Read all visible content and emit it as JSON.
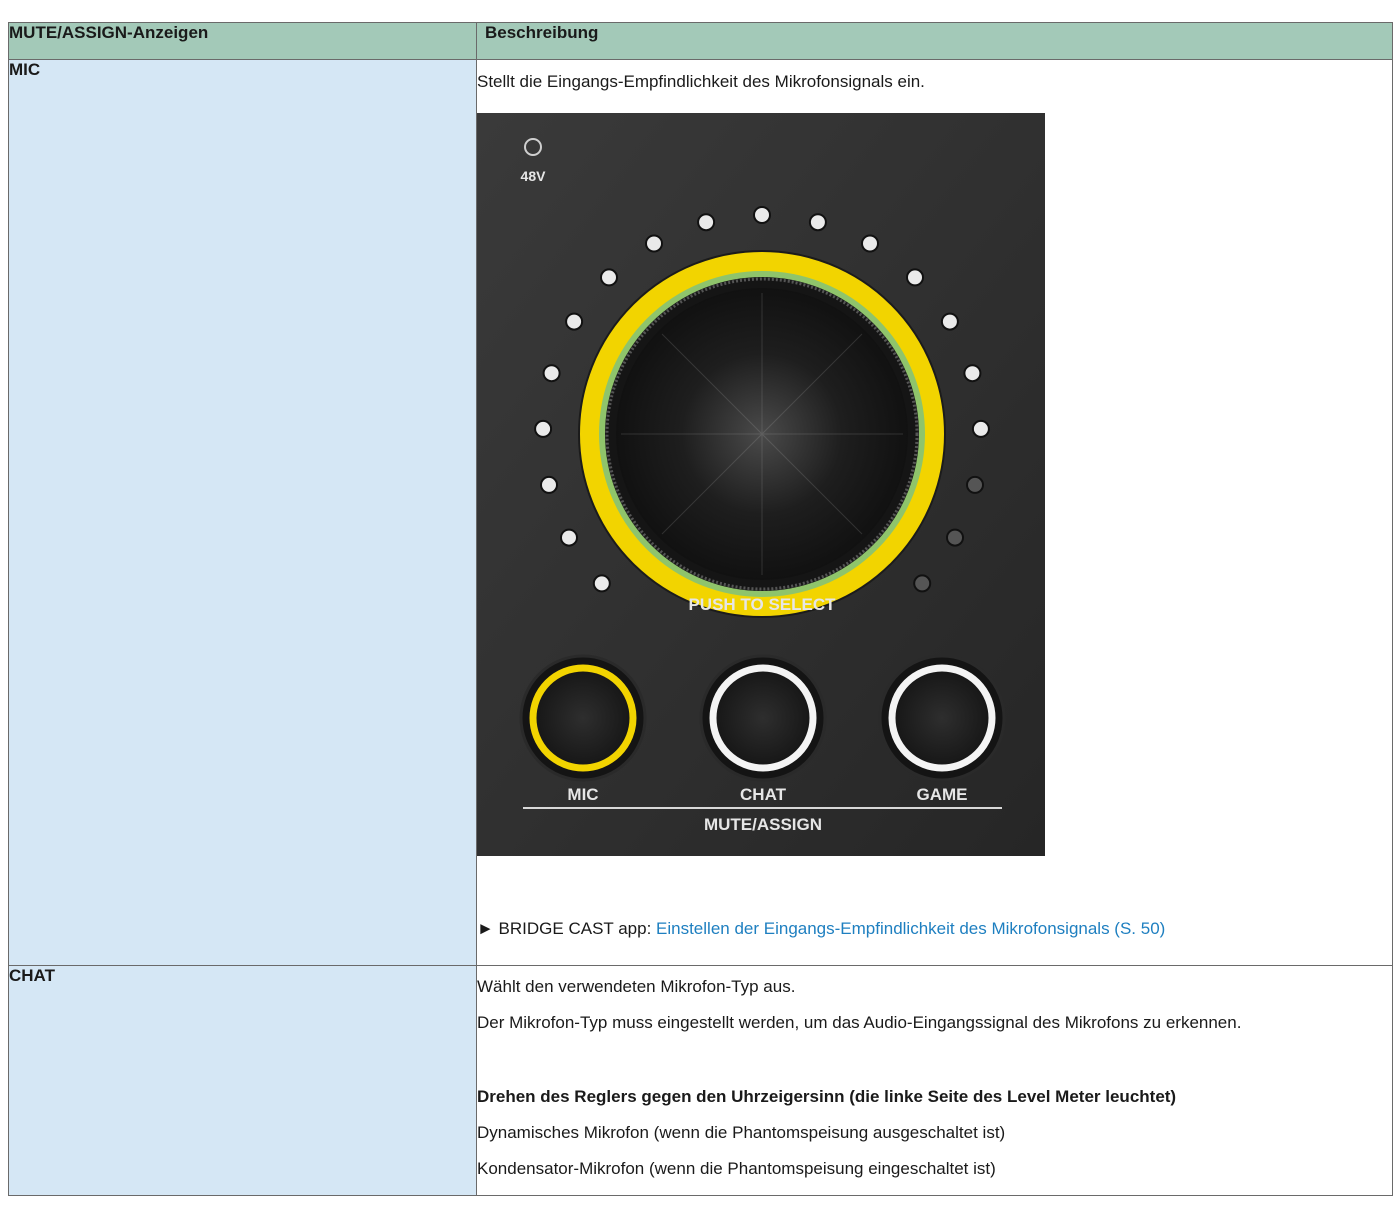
{
  "table": {
    "headers": [
      "MUTE/ASSIGN-Anzeigen",
      "Beschreibung"
    ],
    "rows": [
      {
        "label": "MIC",
        "intro": "Stellt die Eingangs-Empfindlichkeit des Mikrofonsignals ein.",
        "panel": {
          "phantom_label": "48V",
          "push_label": "PUSH TO SELECT",
          "buttons": [
            "MIC",
            "CHAT",
            "GAME"
          ],
          "group_label": "MUTE/ASSIGN",
          "colors": {
            "panel_bg": "#2f2f2f",
            "ring_yellow": "#f2d400",
            "ring_green": "#8fc46b",
            "led_on": "#eaeaea",
            "led_off": "#555555",
            "button_white": "#f4f4f4"
          },
          "level_leds_lit": 16,
          "level_leds_total": 19
        },
        "ref_prefix": "► BRIDGE CAST app: ",
        "ref_link": "Einstellen der Eingangs-Empfindlichkeit des Mikrofonsignals (S. 50)"
      },
      {
        "label": "CHAT",
        "p1": "Wählt den verwendeten Mikrofon-Typ aus.",
        "p2": "Der Mikrofon-Typ muss eingestellt werden, um das Audio-Eingangssignal des Mikrofons zu erkennen.",
        "subheading": "Drehen des Reglers gegen den Uhrzeigersinn (die linke Seite des Level Meter leuchtet)",
        "item1": "Dynamisches Mikrofon (wenn die Phantomspeisung ausgeschaltet ist)",
        "item2": "Kondensator-Mikrofon (wenn die Phantomspeisung eingeschaltet ist)"
      }
    ]
  }
}
